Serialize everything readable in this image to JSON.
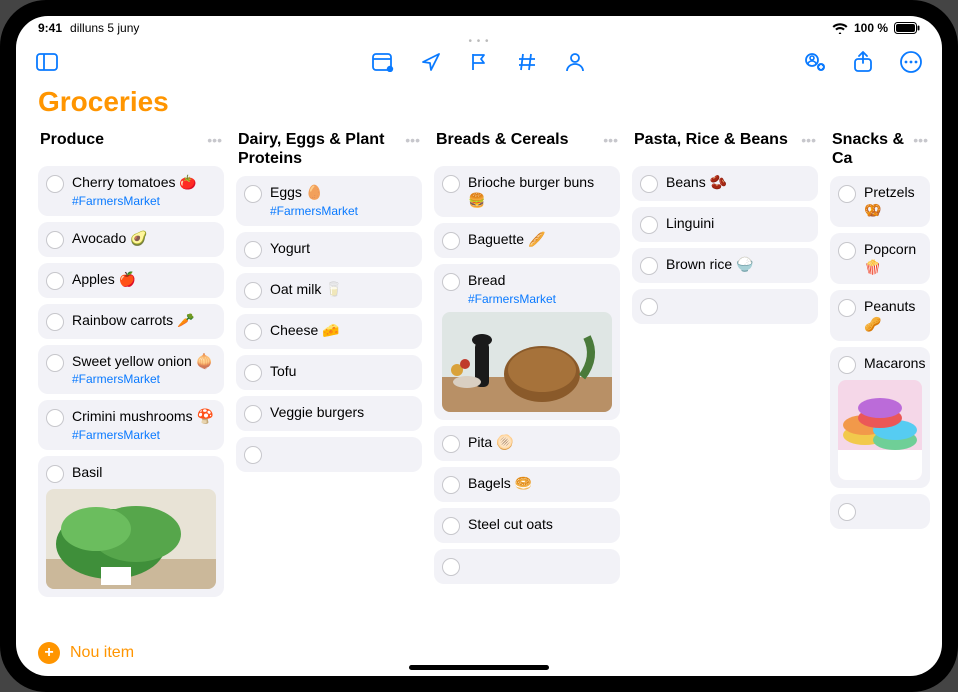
{
  "status": {
    "time": "9:41",
    "date": "dilluns 5 juny",
    "battery_pct": "100 %"
  },
  "title": "Groceries",
  "footer": {
    "add_label": "Nou item"
  },
  "columns": [
    {
      "title": "Produce",
      "items": [
        {
          "text": "Cherry tomatoes 🍅",
          "tag": "#FarmersMarket"
        },
        {
          "text": "Avocado 🥑"
        },
        {
          "text": "Apples 🍎"
        },
        {
          "text": "Rainbow carrots 🥕"
        },
        {
          "text": "Sweet yellow onion 🧅",
          "tag": "#FarmersMarket"
        },
        {
          "text": "Crimini mushrooms 🍄",
          "tag": "#FarmersMarket"
        },
        {
          "text": "Basil",
          "image": "basil"
        }
      ]
    },
    {
      "title": "Dairy, Eggs & Plant Proteins",
      "items": [
        {
          "text": "Eggs 🥚",
          "tag": "#FarmersMarket"
        },
        {
          "text": "Yogurt"
        },
        {
          "text": "Oat milk 🥛"
        },
        {
          "text": "Cheese 🧀"
        },
        {
          "text": "Tofu"
        },
        {
          "text": "Veggie burgers"
        },
        {
          "empty": true
        }
      ]
    },
    {
      "title": "Breads & Cereals",
      "items": [
        {
          "text": "Brioche burger buns 🍔"
        },
        {
          "text": "Baguette 🥖"
        },
        {
          "text": "Bread",
          "tag": "#FarmersMarket",
          "image": "bread"
        },
        {
          "text": "Pita 🫓"
        },
        {
          "text": "Bagels 🥯"
        },
        {
          "text": "Steel cut oats"
        },
        {
          "empty": true
        }
      ]
    },
    {
      "title": "Pasta, Rice & Beans",
      "items": [
        {
          "text": "Beans 🫘"
        },
        {
          "text": "Linguini"
        },
        {
          "text": "Brown rice 🍚"
        },
        {
          "empty": true
        }
      ]
    },
    {
      "title": "Snacks & Ca",
      "cut": true,
      "items": [
        {
          "text": "Pretzels 🥨"
        },
        {
          "text": "Popcorn 🍿"
        },
        {
          "text": "Peanuts 🥜"
        },
        {
          "text": "Macarons",
          "image": "macarons"
        },
        {
          "empty": true
        }
      ]
    }
  ]
}
